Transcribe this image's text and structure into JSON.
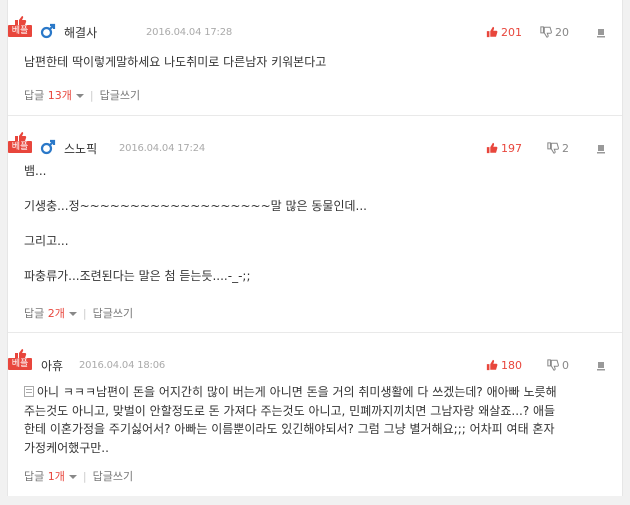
{
  "best_label": "베플",
  "reply_label": "답글",
  "write_reply_label": "답글쓰기",
  "comments": [
    {
      "nickname": "해결사",
      "date": "2016.04.04 17:28",
      "likes": "201",
      "dislikes": "20",
      "lines": [
        "남편한테 딱이렇게말하세요 나도취미로 다른남자 키워본다고"
      ],
      "reply_count": "13",
      "reply_unit": "개"
    },
    {
      "nickname": "스노픽",
      "date": "2016.04.04 17:24",
      "likes": "197",
      "dislikes": "2",
      "lines": [
        "뱀...",
        "기생충...정~~~~~~~~~~~~~~~~~~~말 많은 동물인데...",
        "그리고...",
        "파충류가...조련된다는 말은 첨 듣는듯....-_-;;"
      ],
      "reply_count": "2",
      "reply_unit": "개"
    },
    {
      "nickname": "아휴",
      "date": "2016.04.04 18:06",
      "likes": "180",
      "dislikes": "0",
      "lines": [
        "아니 ㅋㅋㅋ남편이 돈을 어지간히 많이 버는게 아니면 돈을 거의 취미생활에 다 쓰겠는데? 애아빠 노릇해",
        "주는것도 아니고, 맞벌이 안할정도로 돈 가져다 주는것도 아니고, 민폐까지끼치면 그남자랑 왜살죠...? 애들",
        "한테 이혼가정을 주기싫어서? 아빠는 이름뿐이라도 있긴해야되서? 그럼 그냥 별거해요;;; 어차피 여태 혼자",
        "가정케어했구만.."
      ],
      "reply_count": "1",
      "reply_unit": "개"
    }
  ],
  "colors": {
    "accent": "#e8463c",
    "male_icon": "#2a78c8"
  },
  "icons": [
    "thumbs-up-icon",
    "thumbs-down-icon",
    "male-icon",
    "report-icon",
    "document-icon"
  ]
}
